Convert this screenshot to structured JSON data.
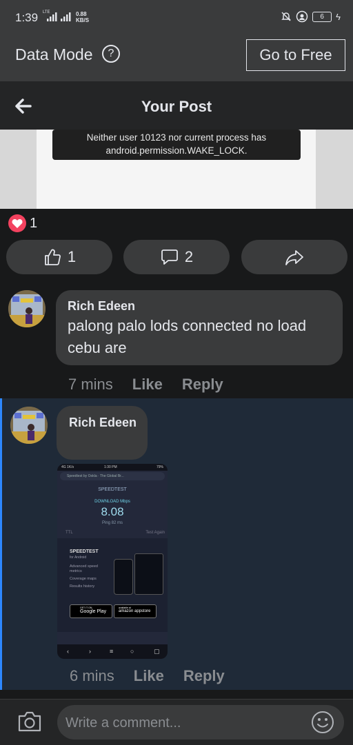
{
  "status_bar": {
    "time": "1:39",
    "network_tag": "LTE",
    "speed_value": "0.88",
    "speed_unit": "KB/S",
    "battery": "6"
  },
  "data_mode": {
    "label": "Data Mode",
    "go_free_label": "Go to Free"
  },
  "header": {
    "title": "Your Post"
  },
  "post": {
    "toast_line1": "Neither user 10123 nor current process has",
    "toast_line2": "android.permission.WAKE_LOCK.",
    "reaction_count": "1",
    "like_count": "1",
    "comment_count": "2",
    "colors": {
      "heart": "#f3425f",
      "accent": "#2d88ff"
    }
  },
  "comments": [
    {
      "author": "Rich Edeen",
      "text": "palong palo lods connected no load cebu are",
      "time": "7 mins",
      "like_label": "Like",
      "reply_label": "Reply"
    },
    {
      "author": "Rich Edeen",
      "time": "6 mins",
      "like_label": "Like",
      "reply_label": "Reply",
      "attachment": {
        "status_left": "4G 1K/s",
        "status_time": "1:30 PM",
        "status_right": "79%",
        "url_bar": "Speedtest by Ookla · The Global Br...",
        "app_title": "SPEEDTEST",
        "download_label": "DOWNLOAD Mbps",
        "download_value": "8.08",
        "ping_label": "Ping 82 ms",
        "isp": "TTL",
        "test_again": "Test Again",
        "promo_title": "SPEEDTEST",
        "promo_subtitle": "for Android",
        "features": [
          "Advanced speed metrics",
          "Coverage maps",
          "Results history"
        ],
        "store1_small": "GET IT ON",
        "store1": "Google Play",
        "store2_small": "available at",
        "store2": "amazon appstore"
      }
    }
  ],
  "composer": {
    "placeholder": "Write a comment..."
  }
}
